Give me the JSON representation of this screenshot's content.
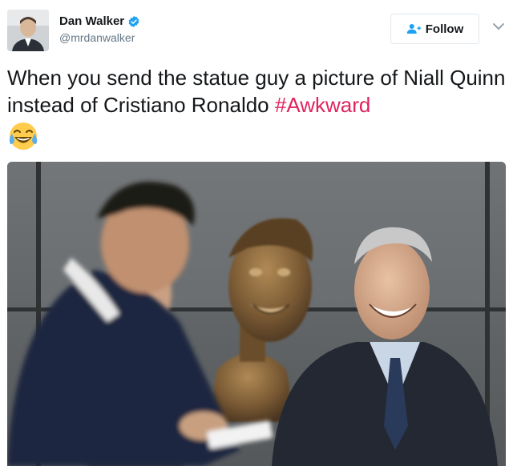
{
  "author": {
    "display_name": "Dan Walker",
    "handle": "@mrdanwalker"
  },
  "actions": {
    "follow_label": "Follow"
  },
  "tweet": {
    "text_main": "When you send the statue guy a picture of Niall Quinn instead of Cristiano Ronaldo ",
    "hashtag": "#Awkward",
    "emoji": "face-with-tears-of-joy"
  },
  "media": {
    "type": "photo",
    "subject": "three-men-with-bronze-bust"
  },
  "colors": {
    "hashtag": "#e0245e",
    "verified": "#1da1f2",
    "handle": "#657786",
    "follow_icon": "#1da1f2"
  },
  "icons": [
    "verified-badge-icon",
    "follow-person-icon",
    "chevron-down-icon"
  ]
}
